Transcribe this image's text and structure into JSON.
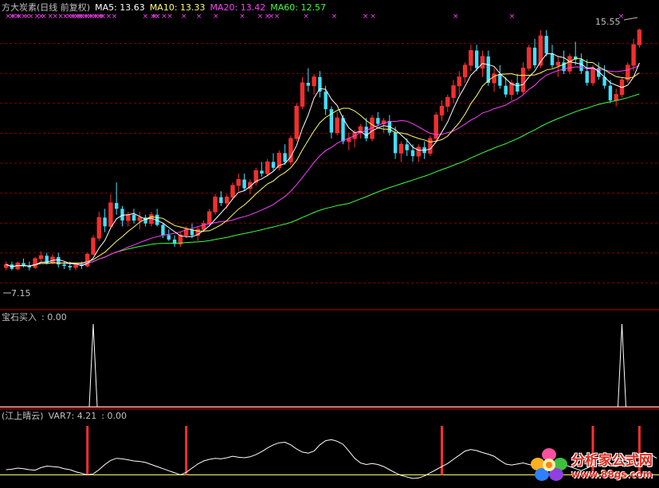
{
  "header": {
    "name": "方大炭素(日线 前复权)",
    "ma5": "MA5: 13.63",
    "ma10": "MA10: 13.33",
    "ma20": "MA20: 13.42",
    "ma60": "MA60: 12.57"
  },
  "colors": {
    "background": "#000000",
    "grid": "#8b0000",
    "divider": "#c00000",
    "up": "#ff3030",
    "down": "#40e0ff",
    "ma5": "#ffffff",
    "ma10": "#ffff66",
    "ma20": "#ff40ff",
    "ma60": "#40ff40",
    "mark": "#ff40ff",
    "text": "#c0c0c0"
  },
  "price_labels": {
    "high": "15.55",
    "low": "7.15"
  },
  "panel2": {
    "title": "宝石买入",
    "value": ": 0.00"
  },
  "panel3": {
    "title": "江上晴云",
    "var7": "VAR7: 4.21",
    "value": ": 0.00"
  },
  "watermark": {
    "brand": "分析家公式网",
    "url": "www.88gs.com",
    "logo": "flower-icon"
  },
  "chart_data": [
    {
      "type": "candlestick",
      "name": "方大炭素(日线 前复权)",
      "ylim": [
        6.8,
        16.2
      ],
      "grid": true,
      "candles": [
        [
          7.4,
          7.6,
          7.3,
          7.5
        ],
        [
          7.5,
          7.6,
          7.3,
          7.35
        ],
        [
          7.35,
          7.6,
          7.3,
          7.55
        ],
        [
          7.55,
          7.7,
          7.4,
          7.45
        ],
        [
          7.45,
          7.6,
          7.3,
          7.4
        ],
        [
          7.4,
          7.75,
          7.35,
          7.7
        ],
        [
          7.7,
          7.95,
          7.6,
          7.8
        ],
        [
          7.8,
          7.9,
          7.5,
          7.55
        ],
        [
          7.55,
          7.85,
          7.5,
          7.75
        ],
        [
          7.75,
          7.9,
          7.4,
          7.5
        ],
        [
          7.5,
          7.6,
          7.35,
          7.45
        ],
        [
          7.45,
          7.6,
          7.3,
          7.4
        ],
        [
          7.4,
          7.55,
          7.3,
          7.5
        ],
        [
          7.5,
          7.6,
          7.35,
          7.45
        ],
        [
          7.45,
          7.9,
          7.4,
          7.85
        ],
        [
          7.85,
          8.5,
          7.8,
          8.4
        ],
        [
          8.4,
          9.3,
          8.3,
          9.1
        ],
        [
          9.1,
          9.4,
          8.6,
          8.8
        ],
        [
          8.8,
          9.9,
          8.7,
          9.6
        ],
        [
          9.6,
          10.3,
          9.2,
          9.4
        ],
        [
          9.4,
          9.5,
          8.8,
          9.0
        ],
        [
          9.0,
          9.3,
          8.8,
          9.2
        ],
        [
          9.2,
          9.4,
          8.9,
          9.0
        ],
        [
          9.0,
          9.3,
          8.7,
          9.1
        ],
        [
          9.1,
          9.2,
          8.8,
          8.9
        ],
        [
          8.9,
          9.3,
          8.8,
          9.2
        ],
        [
          9.2,
          9.4,
          8.8,
          8.85
        ],
        [
          8.85,
          8.9,
          8.4,
          8.5
        ],
        [
          8.5,
          8.7,
          8.3,
          8.35
        ],
        [
          8.35,
          8.5,
          8.1,
          8.2
        ],
        [
          8.2,
          8.6,
          8.1,
          8.5
        ],
        [
          8.5,
          8.8,
          8.4,
          8.7
        ],
        [
          8.7,
          8.9,
          8.4,
          8.5
        ],
        [
          8.5,
          8.8,
          8.3,
          8.7
        ],
        [
          8.7,
          9.0,
          8.6,
          8.9
        ],
        [
          8.9,
          9.4,
          8.8,
          9.3
        ],
        [
          9.3,
          9.9,
          9.2,
          9.8
        ],
        [
          9.8,
          10.0,
          9.5,
          9.6
        ],
        [
          9.6,
          9.9,
          9.4,
          9.8
        ],
        [
          9.8,
          10.3,
          9.7,
          10.2
        ],
        [
          10.2,
          10.6,
          10.0,
          10.4
        ],
        [
          10.4,
          10.6,
          10.0,
          10.1
        ],
        [
          10.1,
          10.4,
          9.9,
          10.3
        ],
        [
          10.3,
          10.8,
          10.2,
          10.7
        ],
        [
          10.7,
          11.0,
          10.5,
          10.6
        ],
        [
          10.6,
          11.1,
          10.5,
          11.0
        ],
        [
          11.0,
          11.3,
          10.7,
          10.8
        ],
        [
          10.8,
          11.4,
          10.7,
          11.3
        ],
        [
          11.3,
          11.6,
          10.9,
          11.0
        ],
        [
          11.0,
          11.9,
          10.9,
          11.8
        ],
        [
          11.8,
          13.0,
          11.7,
          12.9
        ],
        [
          12.9,
          13.9,
          12.8,
          13.7
        ],
        [
          13.7,
          14.2,
          13.4,
          13.6
        ],
        [
          13.6,
          14.0,
          13.3,
          13.9
        ],
        [
          13.9,
          14.1,
          13.2,
          13.4
        ],
        [
          13.4,
          13.6,
          12.6,
          12.8
        ],
        [
          12.8,
          12.9,
          11.8,
          12.0
        ],
        [
          12.0,
          12.7,
          11.9,
          12.5
        ],
        [
          12.5,
          12.6,
          11.6,
          11.7
        ],
        [
          11.7,
          12.0,
          11.4,
          11.8
        ],
        [
          11.8,
          12.1,
          11.5,
          12.0
        ],
        [
          12.0,
          12.3,
          11.8,
          12.2
        ],
        [
          12.2,
          12.5,
          11.7,
          11.8
        ],
        [
          11.8,
          12.6,
          11.7,
          12.5
        ],
        [
          12.5,
          12.7,
          12.2,
          12.3
        ],
        [
          12.3,
          12.5,
          12.0,
          12.4
        ],
        [
          12.4,
          12.6,
          11.9,
          12.0
        ],
        [
          12.0,
          12.2,
          11.1,
          11.3
        ],
        [
          11.3,
          11.7,
          11.0,
          11.6
        ],
        [
          11.6,
          11.8,
          11.2,
          11.4
        ],
        [
          11.4,
          11.6,
          11.0,
          11.2
        ],
        [
          11.2,
          11.6,
          11.0,
          11.5
        ],
        [
          11.5,
          11.7,
          11.1,
          11.3
        ],
        [
          11.3,
          11.9,
          11.2,
          11.8
        ],
        [
          11.8,
          12.7,
          11.7,
          12.6
        ],
        [
          12.6,
          13.1,
          12.4,
          12.9
        ],
        [
          12.9,
          13.3,
          12.7,
          13.2
        ],
        [
          13.2,
          13.8,
          13.0,
          13.6
        ],
        [
          13.6,
          14.1,
          13.3,
          13.9
        ],
        [
          13.9,
          14.4,
          13.7,
          14.3
        ],
        [
          14.3,
          15.0,
          14.1,
          14.8
        ],
        [
          14.8,
          15.0,
          14.1,
          14.2
        ],
        [
          14.2,
          14.8,
          13.9,
          14.6
        ],
        [
          14.6,
          14.8,
          13.6,
          13.7
        ],
        [
          13.7,
          14.2,
          13.4,
          14.0
        ],
        [
          14.0,
          14.3,
          13.5,
          13.6
        ],
        [
          13.6,
          13.9,
          13.2,
          13.3
        ],
        [
          13.3,
          13.8,
          13.1,
          13.7
        ],
        [
          13.7,
          14.0,
          13.3,
          13.4
        ],
        [
          13.4,
          14.4,
          13.3,
          14.2
        ],
        [
          14.2,
          15.0,
          14.1,
          14.9
        ],
        [
          14.9,
          15.2,
          14.2,
          14.3
        ],
        [
          14.3,
          15.5,
          14.2,
          15.3
        ],
        [
          15.3,
          15.5,
          14.6,
          14.7
        ],
        [
          14.7,
          15.0,
          14.2,
          14.3
        ],
        [
          14.3,
          14.6,
          13.9,
          14.4
        ],
        [
          14.4,
          14.8,
          14.0,
          14.1
        ],
        [
          14.1,
          14.7,
          14.0,
          14.6
        ],
        [
          14.6,
          15.1,
          14.3,
          14.5
        ],
        [
          14.5,
          14.7,
          14.0,
          14.1
        ],
        [
          14.1,
          14.5,
          13.6,
          13.7
        ],
        [
          13.7,
          14.3,
          13.6,
          14.2
        ],
        [
          14.2,
          14.4,
          13.8,
          13.9
        ],
        [
          13.9,
          14.3,
          13.5,
          13.6
        ],
        [
          13.6,
          13.8,
          13.0,
          13.1
        ],
        [
          13.1,
          13.5,
          12.9,
          13.3
        ],
        [
          13.3,
          13.9,
          13.2,
          13.8
        ],
        [
          13.8,
          14.4,
          13.7,
          14.3
        ],
        [
          14.3,
          15.2,
          14.1,
          15.0
        ],
        [
          15.0,
          15.55,
          14.9,
          15.5
        ]
      ],
      "series": [
        {
          "name": "MA5",
          "value": 13.63,
          "color": "#ffffff"
        },
        {
          "name": "MA10",
          "value": 13.33,
          "color": "#ffff66"
        },
        {
          "name": "MA20",
          "value": 13.42,
          "color": "#ff40ff"
        },
        {
          "name": "MA60",
          "value": 12.57,
          "color": "#40ff40"
        }
      ],
      "annotations": [
        {
          "text": "15.55"
        },
        {
          "text": "7.15"
        }
      ],
      "marks_x": [
        0.02,
        0.06,
        0.08,
        0.12,
        0.14,
        0.19,
        0.22,
        0.26,
        0.33,
        0.37,
        0.4,
        0.47,
        0.52,
        0.58,
        0.63,
        0.67,
        0.7,
        0.72,
        0.75,
        0.77,
        0.79,
        0.81,
        0.84,
        0.86,
        0.89,
        0.91,
        0.94,
        0.96,
        0.99,
        1.01,
        1.03,
        1.09,
        1.15,
        1.48,
        1.56,
        1.58,
        1.61,
        1.68,
        1.74,
        1.89,
        2.05,
        2.23,
        2.51,
        2.7,
        2.78,
        2.82,
        2.88,
        3.19,
        3.49,
        3.82,
        3.9,
        4.78,
        5.38,
        6.54
      ]
    },
    {
      "type": "line",
      "name": "宝石买入",
      "ylim": [
        0,
        1
      ],
      "values": [
        0,
        0,
        0,
        0,
        0,
        0,
        0,
        0,
        0,
        0,
        0,
        0,
        0,
        0,
        0,
        0,
        0,
        0,
        0,
        0,
        0,
        0,
        0,
        0,
        0,
        0,
        0,
        0,
        0,
        0,
        0,
        0,
        0,
        0,
        0,
        0,
        0,
        0,
        0,
        0,
        0,
        0,
        0,
        0,
        0,
        0,
        0,
        0,
        0,
        0,
        0,
        0,
        0,
        0,
        0,
        0,
        0,
        0,
        0,
        0,
        0,
        0,
        0,
        0,
        0,
        0,
        0,
        0,
        0,
        0,
        0,
        0,
        0,
        0,
        0,
        0,
        0,
        0,
        0,
        0,
        0,
        0,
        0,
        0,
        0,
        0,
        0,
        0,
        0,
        0,
        0,
        0,
        0,
        0,
        0,
        0,
        0,
        0,
        0,
        0,
        0,
        0,
        0,
        0,
        0,
        0,
        0,
        0,
        0,
        0,
        0,
        0,
        0
      ],
      "spikes": [
        15,
        106
      ],
      "current": 0.0
    },
    {
      "type": "line",
      "name": "江上晴云",
      "ylim": [
        0,
        10
      ],
      "var7": [
        2.0,
        2.1,
        2.3,
        2.2,
        2.0,
        1.9,
        2.4,
        2.7,
        2.6,
        2.5,
        2.2,
        2.0,
        1.6,
        1.3,
        1.0,
        1.2,
        2.0,
        3.0,
        3.8,
        4.2,
        4.1,
        3.9,
        3.7,
        3.6,
        3.4,
        3.0,
        2.6,
        2.2,
        1.8,
        1.4,
        1.0,
        1.5,
        2.3,
        3.1,
        3.7,
        4.0,
        4.2,
        4.1,
        4.3,
        4.6,
        4.4,
        4.3,
        4.5,
        4.9,
        5.5,
        6.2,
        6.8,
        7.2,
        7.3,
        6.8,
        6.0,
        5.4,
        5.2,
        5.6,
        6.8,
        7.6,
        7.8,
        7.5,
        6.9,
        5.6,
        4.2,
        3.3,
        3.0,
        3.2,
        3.0,
        2.6,
        2.0,
        1.4,
        0.9,
        0.6,
        0.3,
        0.4,
        0.8,
        1.4,
        2.0,
        2.6,
        3.2,
        4.0,
        4.8,
        5.6,
        5.9,
        5.7,
        5.3,
        5.0,
        4.6,
        3.8,
        3.1,
        2.9,
        3.1,
        3.3,
        3.0,
        2.8,
        2.6,
        2.8,
        3.1,
        3.3,
        3.0,
        2.6,
        2.2,
        1.8,
        2.3,
        2.9,
        3.2,
        3.0,
        2.8,
        2.6,
        3.0,
        3.6,
        4.4,
        5.0,
        5.3,
        4.9,
        4.2
      ],
      "signals": [
        14,
        31,
        75,
        101,
        109
      ],
      "baseline": 1.0,
      "var7_current": 4.21,
      "current": 0.0
    }
  ]
}
